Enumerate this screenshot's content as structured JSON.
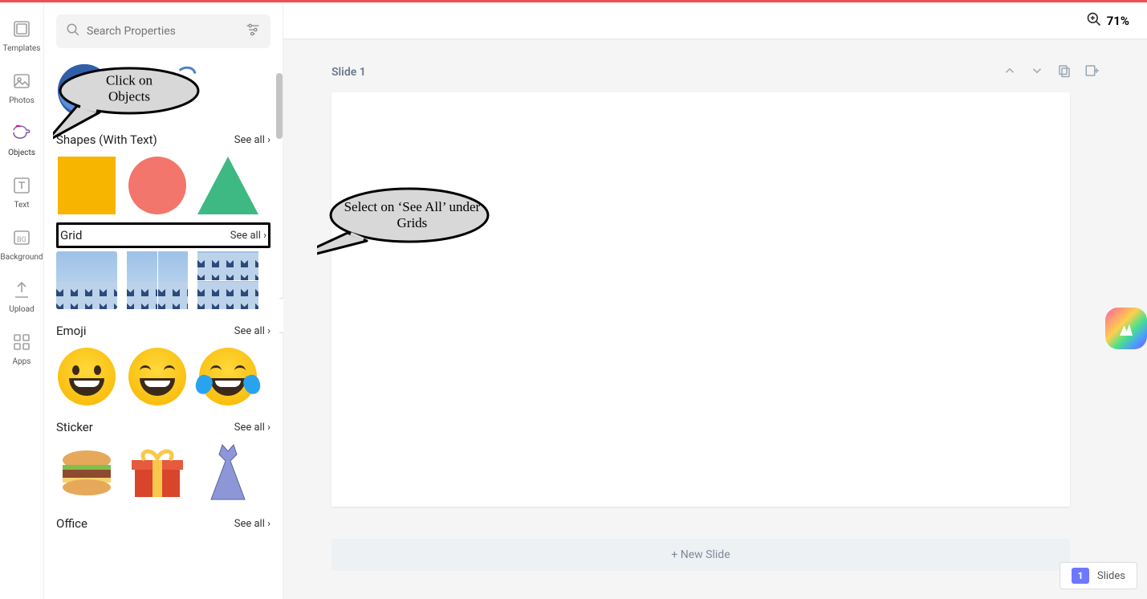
{
  "nav": {
    "templates": "Templates",
    "photos": "Photos",
    "objects": "Objects",
    "text": "Text",
    "background": "Background",
    "upload": "Upload",
    "apps": "Apps"
  },
  "search": {
    "placeholder": "Search Properties"
  },
  "sections": {
    "shapes": {
      "title": "Shapes (With Text)",
      "see_all": "See all"
    },
    "grid": {
      "title": "Grid",
      "see_all": "See all"
    },
    "emoji": {
      "title": "Emoji",
      "see_all": "See all"
    },
    "sticker": {
      "title": "Sticker",
      "see_all": "See all"
    },
    "office": {
      "title": "Office",
      "see_all": "See all"
    }
  },
  "stage": {
    "zoom": "71%",
    "slide_title": "Slide 1",
    "new_slide": "+ New Slide",
    "slides_button": "Slides",
    "slides_count": "1"
  },
  "callouts": {
    "objects": "Click on Objects",
    "grid": "Select on ‘See All’ under Grids"
  }
}
